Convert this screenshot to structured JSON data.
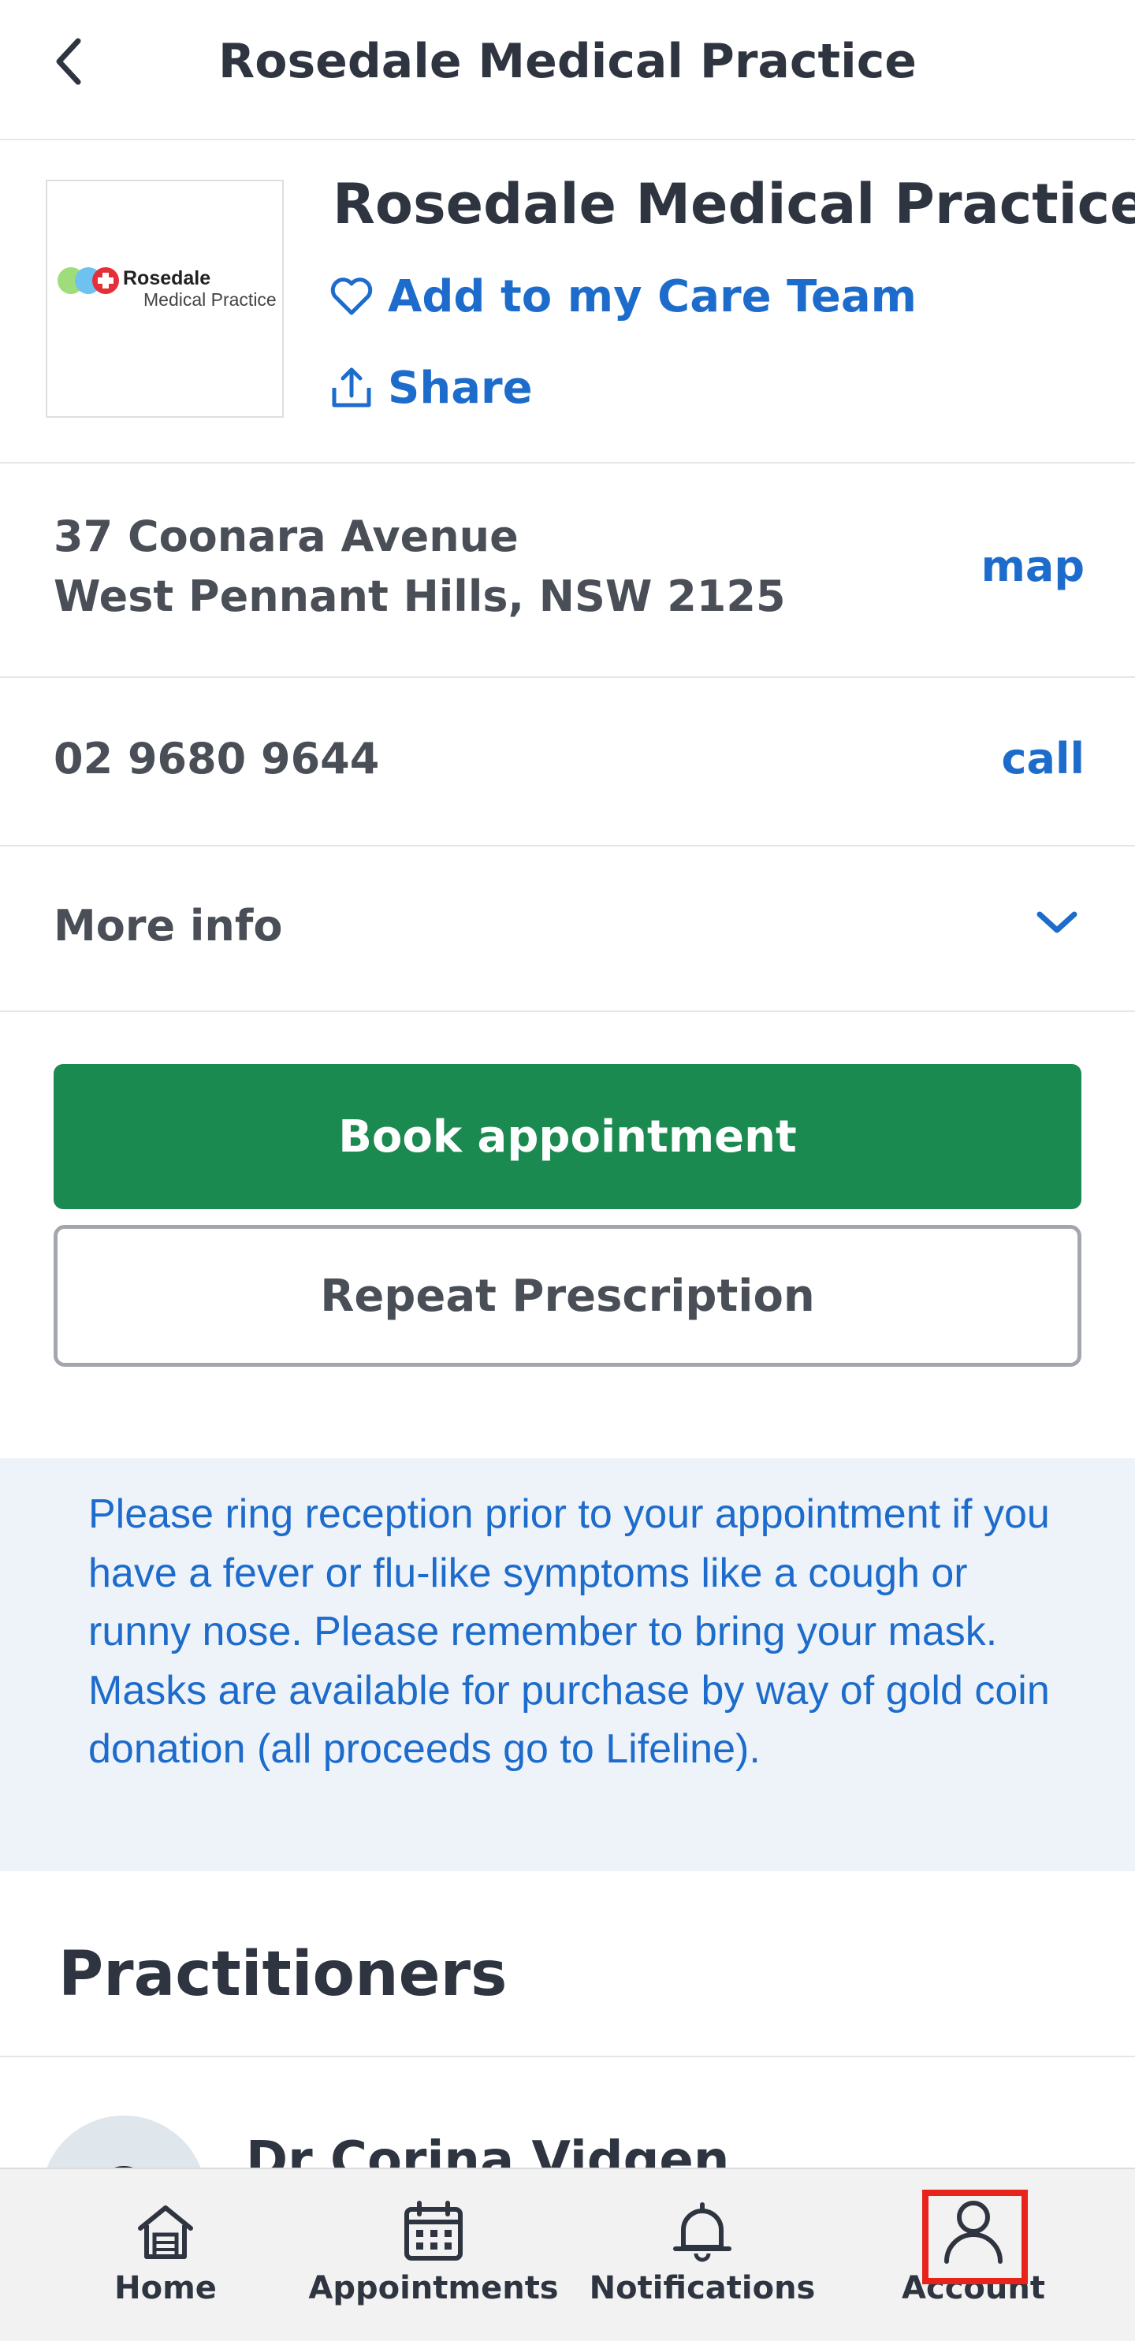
{
  "header": {
    "title": "Rosedale Medical Practice"
  },
  "practice": {
    "name": "Rosedale Medical Practice",
    "logo_text_line1": "Rosedale",
    "logo_text_line2": "Medical Practice",
    "add_care_team_label": "Add to my Care Team",
    "share_label": "Share"
  },
  "address": {
    "line1": "37 Coonara Avenue",
    "line2": "West Pennant Hills, NSW 2125",
    "action_label": "map"
  },
  "phone": {
    "number": "02 9680 9644",
    "action_label": "call"
  },
  "more_info": {
    "label": "More info"
  },
  "actions": {
    "book_label": "Book appointment",
    "repeat_label": "Repeat Prescription"
  },
  "notice": {
    "text": "Please ring reception prior to your appointment if you have a fever or flu-like symptoms like a cough or runny nose. Please remember to bring your mask. Masks are available for purchase by way of gold coin donation (all proceeds go to Lifeline)."
  },
  "practitioners": {
    "heading": "Practitioners",
    "items": [
      {
        "name": "Dr Corina Vidgen"
      }
    ]
  },
  "bottom_nav": {
    "items": [
      {
        "label": "Home",
        "icon": "home-icon"
      },
      {
        "label": "Appointments",
        "icon": "calendar-icon"
      },
      {
        "label": "Notifications",
        "icon": "bell-icon"
      },
      {
        "label": "Account",
        "icon": "user-icon"
      }
    ]
  },
  "colors": {
    "accent_blue": "#1d6ccc",
    "book_green": "#1b8a50",
    "notice_background": "#eef3f9",
    "highlight_red": "#e8231b"
  }
}
